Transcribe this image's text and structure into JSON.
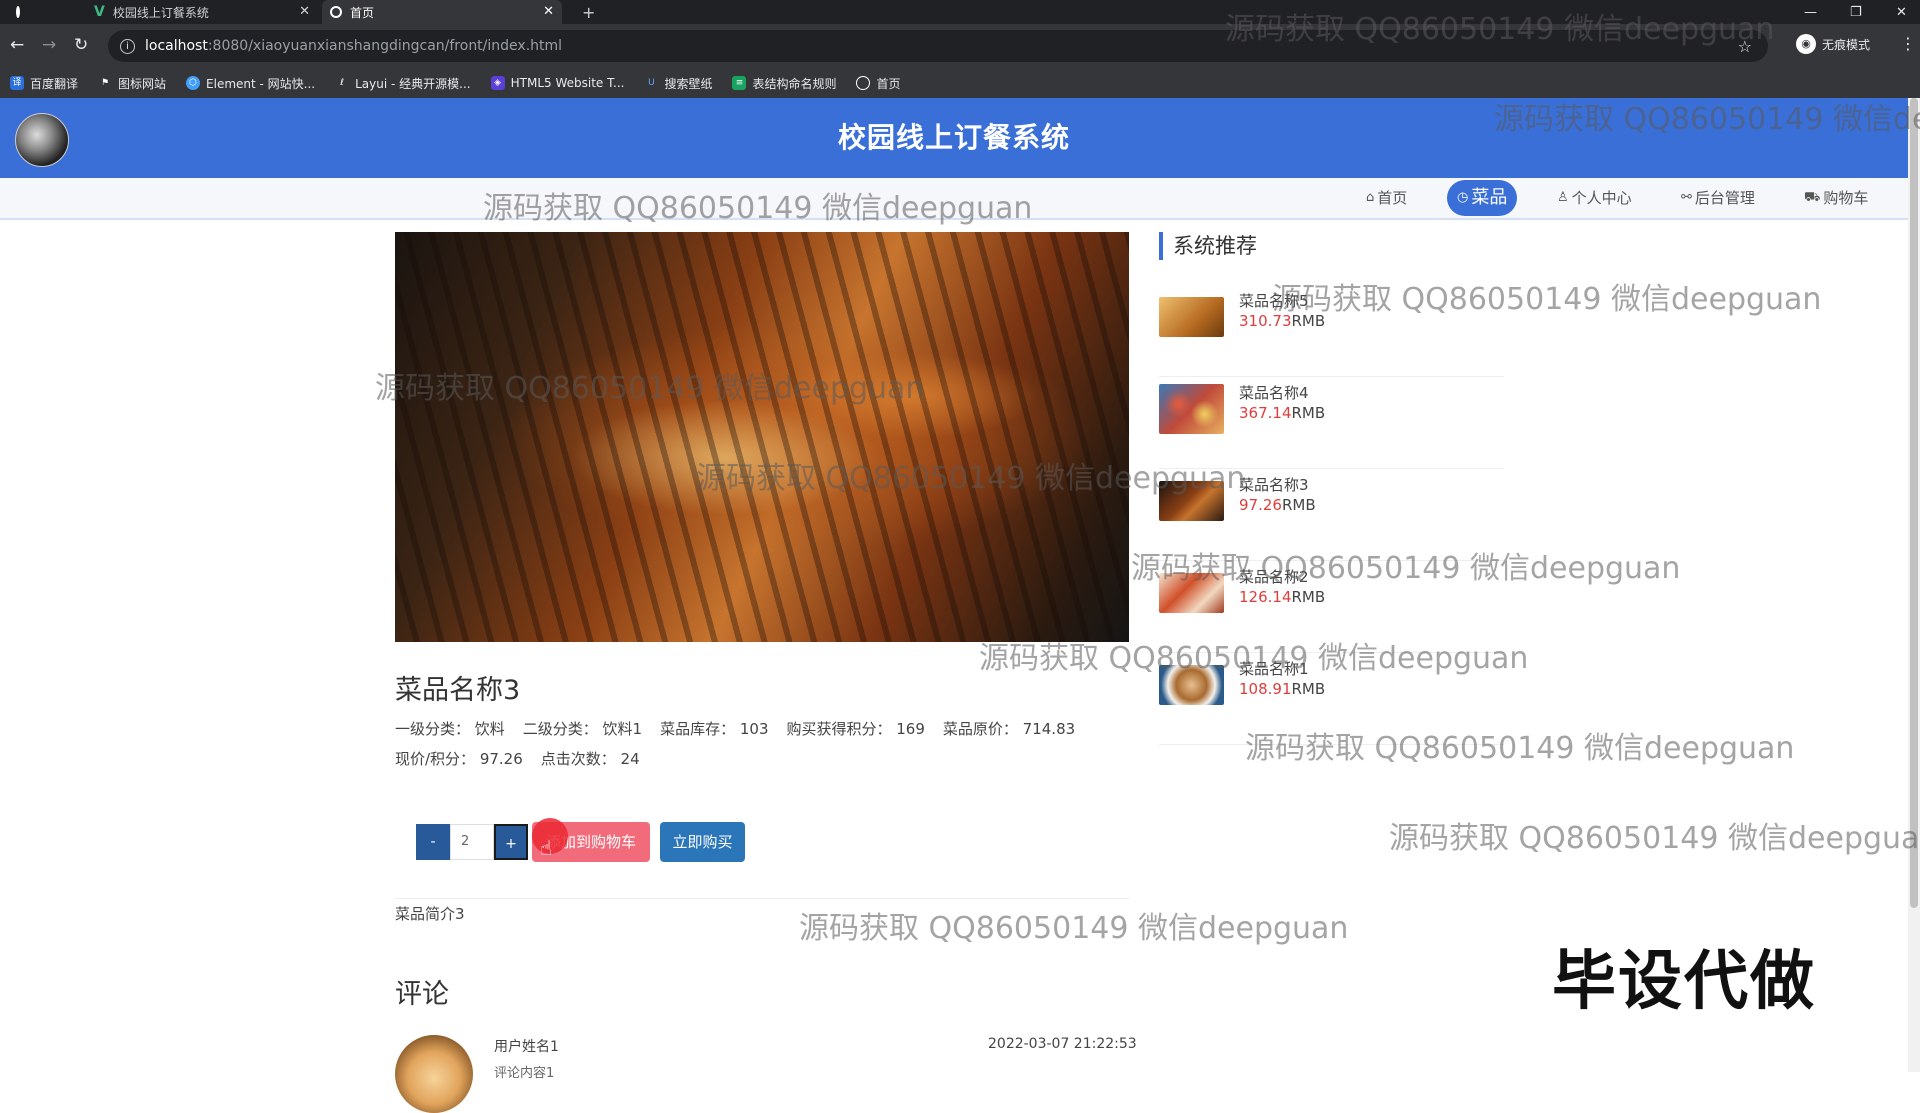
{
  "browser": {
    "tabs": [
      {
        "title": "校园线上订餐系统",
        "active": false
      },
      {
        "title": "首页",
        "active": true
      }
    ],
    "new_tab": "+",
    "window_controls": [
      "—",
      "❐",
      "✕"
    ],
    "url_host": "localhost",
    "url_path": ":8080/xiaoyuanxianshangdingcan/front/index.html",
    "profile_label": "无痕模式",
    "bookmarks": [
      {
        "label": "百度翻译",
        "color": "#2a6fdb"
      },
      {
        "label": "图标网站",
        "color": "#ffffff"
      },
      {
        "label": "Element - 网站快...",
        "color": "#409eff"
      },
      {
        "label": "Layui - 经典开源模...",
        "color": "#333333"
      },
      {
        "label": "HTML5 Website T...",
        "color": "#5b3fd6"
      },
      {
        "label": "搜索壁纸",
        "color": "#2a6fdb"
      },
      {
        "label": "表结构命名规则",
        "color": "#1aa260"
      },
      {
        "label": "首页",
        "color": "#ffffff"
      }
    ]
  },
  "site": {
    "title": "校园线上订餐系统",
    "nav": [
      {
        "label": "首页",
        "icon": "home-icon",
        "active": false
      },
      {
        "label": "菜品",
        "icon": "clock-icon",
        "active": true
      },
      {
        "label": "个人中心",
        "icon": "user-icon",
        "active": false
      },
      {
        "label": "后台管理",
        "icon": "link-icon",
        "active": false
      },
      {
        "label": "购物车",
        "icon": "cart-icon",
        "active": false
      }
    ],
    "accent": "#3a6fd8"
  },
  "dish": {
    "name": "菜品名称3",
    "specs_line1": [
      "一级分类： 饮料",
      "二级分类： 饮料1",
      "菜品库存： 103",
      "购买获得积分： 169",
      "菜品原价： 714.83"
    ],
    "specs_line2": [
      "现价/积分： 97.26",
      "点击次数： 24"
    ],
    "quantity": "2",
    "minus": "-",
    "plus": "+",
    "add_to_cart": "添加到购物车",
    "buy_now": "立即购买",
    "intro": "菜品简介3"
  },
  "recommend": {
    "title": "系统推荐",
    "items": [
      {
        "name": "菜品名称5",
        "price": "310.73",
        "unit": "RMB"
      },
      {
        "name": "菜品名称4",
        "price": "367.14",
        "unit": "RMB"
      },
      {
        "name": "菜品名称3",
        "price": "97.26",
        "unit": "RMB"
      },
      {
        "name": "菜品名称2",
        "price": "126.14",
        "unit": "RMB"
      },
      {
        "name": "菜品名称1",
        "price": "108.91",
        "unit": "RMB"
      }
    ]
  },
  "comments": {
    "title": "评论",
    "items": [
      {
        "user": "用户姓名1",
        "text": "评论内容1",
        "time": "2022-03-07 21:22:53"
      }
    ]
  },
  "watermarks": {
    "text": "源码获取 QQ86050149 微信deepguan",
    "stamp": "毕设代做"
  }
}
